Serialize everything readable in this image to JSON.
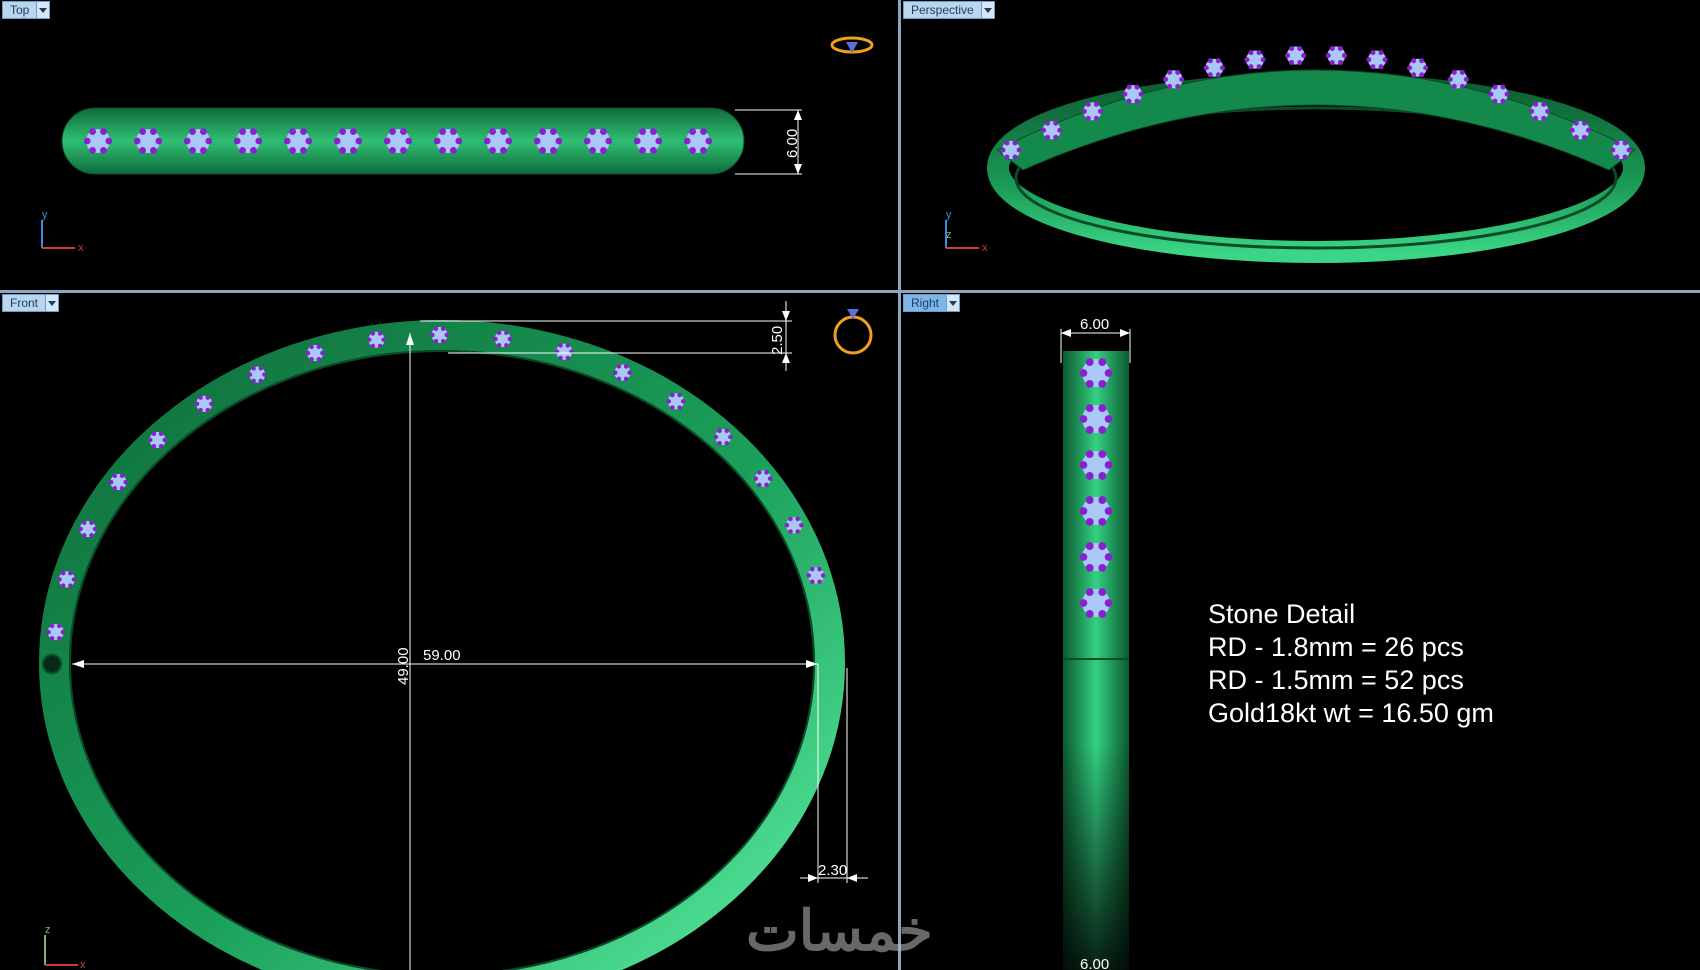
{
  "viewports": {
    "top": {
      "label": "Top",
      "dimension": "6.00",
      "axis_x": "x",
      "axis_y": "y"
    },
    "perspective": {
      "label": "Perspective",
      "axis_x": "x",
      "axis_y": "y",
      "axis_z": "z"
    },
    "front": {
      "label": "Front",
      "dim_width": "59.00",
      "dim_height": "49.00",
      "dim_top": "2.50",
      "dim_side": "2.30",
      "axis_x": "x",
      "axis_z": "z"
    },
    "right": {
      "label": "Right",
      "dim_top": "6.00",
      "dim_bottom": "6.00"
    }
  },
  "stone_detail": {
    "title": "Stone Detail",
    "lines": [
      "RD - 1.8mm = 26 pcs",
      "RD - 1.5mm = 52 pcs",
      "Gold18kt wt = 16.50 gm"
    ]
  },
  "watermark": "خمسات",
  "colors": {
    "metal": "#1fae62",
    "stone": "#a9c8f5",
    "prong": "#8a1fd0",
    "background": "#000000",
    "tab": "#b9d6ee"
  },
  "icons": [
    "ring-icon",
    "ring-icon-front"
  ]
}
